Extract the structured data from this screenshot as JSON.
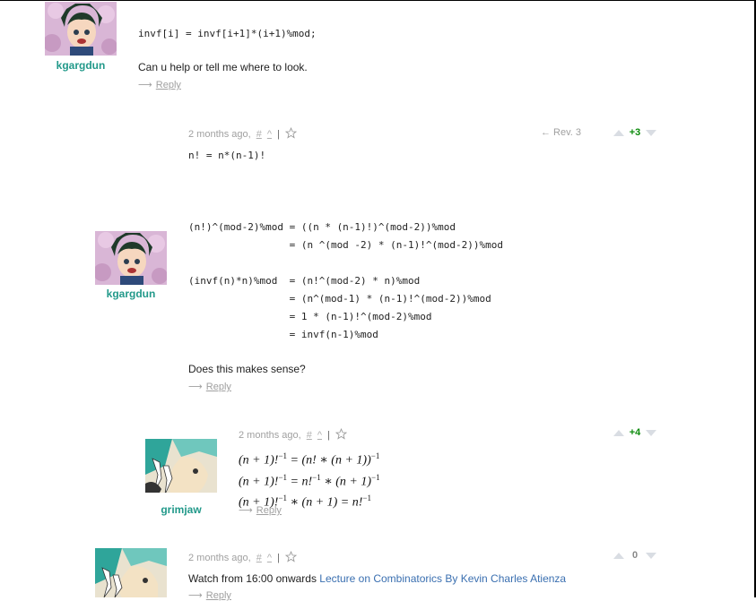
{
  "comments": [
    {
      "username": "kgargdun",
      "code": "invf[i] = invf[i+1]*(i+1)%mod;",
      "text": "Can u help or tell me where to look.",
      "reply": "Reply"
    },
    {
      "username": "kgargdun",
      "time": "2 months ago,",
      "hash": "#",
      "caret": "^",
      "sep": "|",
      "revision": "← Rev. 3",
      "vote": "+3",
      "code1": "n! = n*(n-1)!",
      "code2": "(n!)^(mod-2)%mod = ((n * (n-1)!)^(mod-2))%mod\n                 = (n ^(mod -2) * (n-1)!^(mod-2))%mod\n\n(invf(n)*n)%mod  = (n!^(mod-2) * n)%mod\n                 = (n^(mod-1) * (n-1)!^(mod-2))%mod\n                 = 1 * (n-1)!^(mod-2)%mod\n                 = invf(n-1)%mod",
      "text": "Does this makes sense?",
      "reply": "Reply"
    },
    {
      "username": "grimjaw",
      "time": "2 months ago,",
      "hash": "#",
      "caret": "^",
      "sep": "|",
      "vote": "+4",
      "math": {
        "l1_lhs": "(n + 1)!",
        "l1_lhs_sup": "−1",
        "l1_rhs": " = (n! ∗ (n + 1))",
        "l1_rhs_sup": "−1",
        "l2_lhs": "(n + 1)!",
        "l2_lhs_sup": "−1",
        "l2_mid": " = n!",
        "l2_mid_sup": "−1",
        "l2_rhs": " ∗ (n + 1)",
        "l2_rhs_sup": "−1",
        "l3_lhs": "(n + 1)!",
        "l3_lhs_sup": "−1",
        "l3_mid": " ∗ (n + 1) = n!",
        "l3_mid_sup": "−1"
      },
      "reply": "Reply"
    },
    {
      "time": "2 months ago,",
      "hash": "#",
      "caret": "^",
      "sep": "|",
      "vote": "0",
      "text": "Watch from 16:00 onwards ",
      "link": "Lecture on Combinatorics By Kevin Charles Atienza",
      "reply": "Reply"
    }
  ],
  "colors": {
    "username": "#22998a",
    "positive_vote": "#0b8a0b",
    "link": "#3a6fb0"
  },
  "icons": [
    "star-icon",
    "upvote-icon",
    "downvote-icon",
    "reply-arrow-icon",
    "avatar-image"
  ]
}
